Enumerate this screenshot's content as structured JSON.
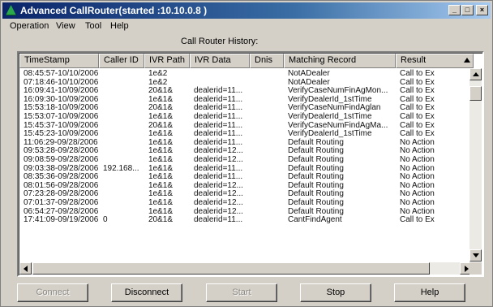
{
  "window": {
    "title": "Advanced CallRouter(started :10.10.0.8 )",
    "minimize_glyph": "_",
    "maximize_glyph": "□",
    "close_glyph": "×"
  },
  "menu": [
    {
      "label": "Operation"
    },
    {
      "label": "View"
    },
    {
      "label": "Tool"
    },
    {
      "label": "Help"
    }
  ],
  "history_label": "Call Router History:",
  "columns": [
    "TimeStamp",
    "Caller ID",
    "IVR Path",
    "IVR Data",
    "Dnis",
    "Matching Record",
    "Result"
  ],
  "rows": [
    [
      "08:45:57-10/10/2006",
      "",
      "1e&2",
      "",
      "",
      "NotADealer",
      "Call to Ex"
    ],
    [
      "07:18:46-10/10/2006",
      "",
      "1e&2",
      "",
      "",
      "NotADealer",
      "Call to Ex"
    ],
    [
      "16:09:41-10/09/2006",
      "",
      "20&1&",
      "dealerid=11...",
      "",
      "VerifyCaseNumFinAgMon...",
      "Call to Ex"
    ],
    [
      "16:09:30-10/09/2006",
      "",
      "1e&1&",
      "dealerid=11...",
      "",
      "VerifyDealerId_1stTime",
      "Call to Ex"
    ],
    [
      "15:53:18-10/09/2006",
      "",
      "20&1&",
      "dealerid=11...",
      "",
      "VerifyCaseNumFindAglan",
      "Call to Ex"
    ],
    [
      "15:53:07-10/09/2006",
      "",
      "1e&1&",
      "dealerid=11...",
      "",
      "VerifyDealerId_1stTime",
      "Call to Ex"
    ],
    [
      "15:45:37-10/09/2006",
      "",
      "20&1&",
      "dealerid=11...",
      "",
      "VerifyCaseNumFindAgMa...",
      "Call to Ex"
    ],
    [
      "15:45:23-10/09/2006",
      "",
      "1e&1&",
      "dealerid=11...",
      "",
      "VerifyDealerId_1stTime",
      "Call to Ex"
    ],
    [
      "11:06:29-09/28/2006",
      "",
      "1e&1&",
      "dealerid=11...",
      "",
      "Default Routing",
      "No Action"
    ],
    [
      "09:53:28-09/28/2006",
      "",
      "1e&1&",
      "dealerid=12...",
      "",
      "Default Routing",
      "No Action"
    ],
    [
      "09:08:59-09/28/2006",
      "",
      "1e&1&",
      "dealerid=12...",
      "",
      "Default Routing",
      "No Action"
    ],
    [
      "09:03:38-09/28/2006",
      "192.168...",
      "1e&1&",
      "dealerid=11...",
      "",
      "Default Routing",
      "No Action"
    ],
    [
      "08:35:36-09/28/2006",
      "",
      "1e&1&",
      "dealerid=11...",
      "",
      "Default Routing",
      "No Action"
    ],
    [
      "08:01:56-09/28/2006",
      "",
      "1e&1&",
      "dealerid=12...",
      "",
      "Default Routing",
      "No Action"
    ],
    [
      "07:23:28-09/28/2006",
      "",
      "1e&1&",
      "dealerid=12...",
      "",
      "Default Routing",
      "No Action"
    ],
    [
      "07:01:37-09/28/2006",
      "",
      "1e&1&",
      "dealerid=12...",
      "",
      "Default Routing",
      "No Action"
    ],
    [
      "06:54:27-09/28/2006",
      "",
      "1e&1&",
      "dealerid=12...",
      "",
      "Default Routing",
      "No Action"
    ],
    [
      "17:41:09-09/19/2006",
      "0",
      "20&1&",
      "dealerid=11...",
      "",
      "CantFindAgent",
      "Call to Ex"
    ]
  ],
  "buttons": {
    "connect": "Connect",
    "disconnect": "Disconnect",
    "start": "Start",
    "stop": "Stop",
    "help": "Help"
  },
  "colors": {
    "titlebar_start": "#0a246a",
    "titlebar_end": "#a6caf0",
    "face": "#d4d0c8",
    "disabled_text": "#8c8a84"
  }
}
